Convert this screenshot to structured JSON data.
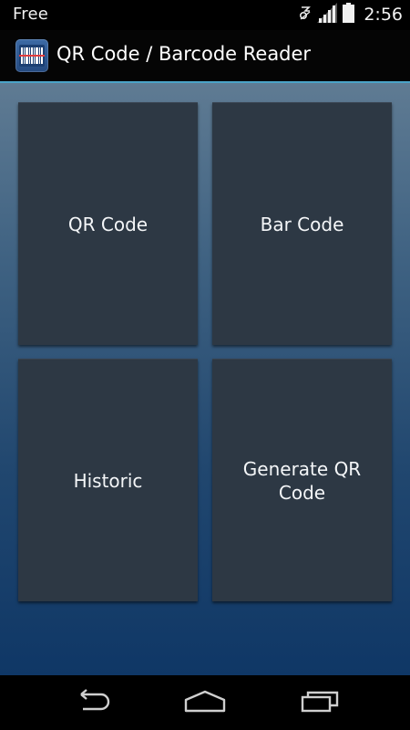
{
  "status_bar": {
    "carrier_label": "Free",
    "time": "2:56",
    "icons": [
      "data-sync-icon",
      "signal-icon",
      "battery-icon"
    ]
  },
  "action_bar": {
    "app_icon": "barcode-app-icon",
    "title": "QR Code / Barcode Reader",
    "accent_color": "#4aa3c8"
  },
  "tiles": [
    {
      "label": "QR Code"
    },
    {
      "label": "Bar Code"
    },
    {
      "label": "Historic"
    },
    {
      "label": "Generate QR Code"
    }
  ],
  "nav_bar": {
    "buttons": [
      "back-icon",
      "home-icon",
      "recent-apps-icon"
    ]
  },
  "colors": {
    "tile_bg": "#2d3844",
    "content_gradient_top": "#5f7b93",
    "content_gradient_bottom": "#0f3766"
  }
}
